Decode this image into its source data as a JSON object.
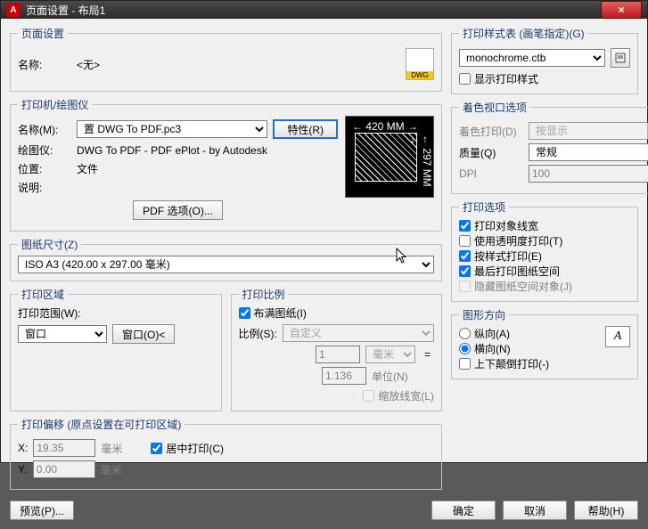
{
  "window": {
    "title": "页面设置 - 布局1"
  },
  "pageSetup": {
    "legend": "页面设置",
    "nameLabel": "名称:",
    "nameValue": "<无>"
  },
  "printer": {
    "legend": "打印机/绘图仪",
    "nameLabel": "名称(M):",
    "nameValue": "置 DWG To PDF.pc3",
    "propsBtn": "特性(R)",
    "plotterLabel": "绘图仪:",
    "plotterValue": "DWG To PDF - PDF ePlot - by Autodesk",
    "locLabel": "位置:",
    "locValue": "文件",
    "descLabel": "说明:",
    "descValue": "",
    "pdfBtn": "PDF 选项(O)...",
    "previewTop": "← 420 MM →",
    "previewSide": "← 297 MM →"
  },
  "paper": {
    "legend": "图纸尺寸(Z)",
    "value": "ISO A3 (420.00 x 297.00 毫米)"
  },
  "area": {
    "legend": "打印区域",
    "rangeLabel": "打印范围(W):",
    "rangeValue": "窗口",
    "windowBtn": "窗口(O)<"
  },
  "scale": {
    "legend": "打印比例",
    "fitLabel": "布满图纸(I)",
    "ratioLabel": "比例(S):",
    "ratioValue": "自定义",
    "unitsA": "1",
    "unitsASel": "毫米",
    "unitsB": "1.136",
    "unitsBLabel": "单位(N)",
    "scaleLw": "缩放线宽(L)"
  },
  "offset": {
    "legend": "打印偏移 (原点设置在可打印区域)",
    "xLabel": "X:",
    "xValue": "19.35",
    "xUnit": "毫米",
    "yLabel": "Y:",
    "yValue": "0.00",
    "yUnit": "毫米",
    "centerLabel": "居中打印(C)"
  },
  "styleTable": {
    "legend": "打印样式表 (画笔指定)(G)",
    "value": "monochrome.ctb",
    "showLabel": "显示打印样式"
  },
  "shaded": {
    "legend": "着色视口选项",
    "shadeLabel": "着色打印(D)",
    "shadeValue": "按显示",
    "qualityLabel": "质量(Q)",
    "qualityValue": "常规",
    "dpiLabel": "DPI",
    "dpiValue": "100"
  },
  "options": {
    "legend": "打印选项",
    "o1": "打印对象线宽",
    "o2": "使用透明度打印(T)",
    "o3": "按样式打印(E)",
    "o4": "最后打印图纸空间",
    "o5": "隐藏图纸空间对象(J)"
  },
  "orient": {
    "legend": "图形方向",
    "portrait": "纵向(A)",
    "landscape": "横向(N)",
    "upside": "上下颠倒打印(-)"
  },
  "footer": {
    "preview": "预览(P)...",
    "ok": "确定",
    "cancel": "取消",
    "help": "帮助(H)"
  }
}
